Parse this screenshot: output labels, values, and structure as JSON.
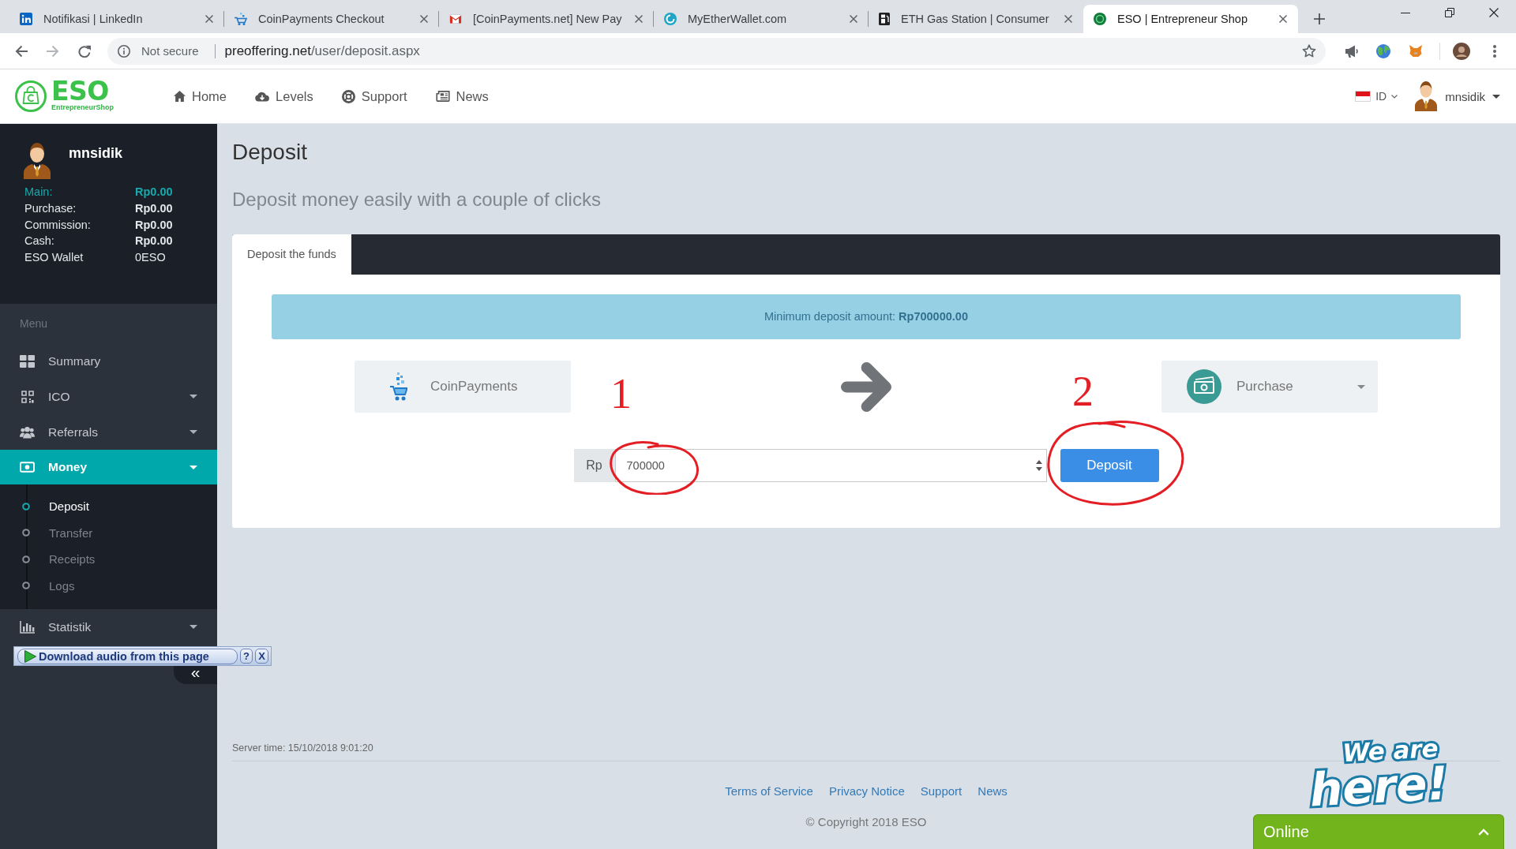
{
  "browser": {
    "tabs": [
      {
        "title": "Notifikasi | LinkedIn",
        "kind": "in-square",
        "selected": false
      },
      {
        "title": "CoinPayments Checkout",
        "kind": "cart",
        "selected": false
      },
      {
        "title": "[CoinPayments.net] New Pay",
        "kind": "mail",
        "selected": false
      },
      {
        "title": "MyEtherWallet.com",
        "kind": "swirl",
        "selected": false
      },
      {
        "title": "ETH Gas Station | Consumer",
        "kind": "pump",
        "selected": false
      },
      {
        "title": "ESO | Entrepreneur Shop",
        "kind": "disc",
        "selected": true
      }
    ],
    "address_bar": {
      "security": "Not secure",
      "host": "preoffering.net",
      "path": "/user/deposit.aspx"
    }
  },
  "header": {
    "logo": {
      "mark": "ESO",
      "tagline": "EntrepreneurShop"
    },
    "nav": [
      {
        "label": "Home",
        "kind": "home"
      },
      {
        "label": "Levels",
        "kind": "cloud"
      },
      {
        "label": "Support",
        "kind": "lifebuoy"
      },
      {
        "label": "News",
        "kind": "newspaper"
      }
    ],
    "language": "ID",
    "user": "mnsidik"
  },
  "sidebar": {
    "profile": {
      "name": "mnsidik",
      "balances": [
        {
          "label": "Main:",
          "value": "Rp0.00",
          "selected": true
        },
        {
          "label": "Purchase:",
          "value": "Rp0.00",
          "selected": false
        },
        {
          "label": "Commission:",
          "value": "Rp0.00",
          "selected": false
        },
        {
          "label": "Cash:",
          "value": "Rp0.00",
          "selected": false
        }
      ],
      "wallet": {
        "label": "ESO Wallet",
        "value": "0ESO"
      }
    },
    "menu_label": "Menu",
    "items": [
      {
        "label": "Summary",
        "kind": "grid",
        "dropdown": false,
        "selected": false
      },
      {
        "label": "ICO",
        "kind": "qr",
        "dropdown": true,
        "selected": false
      },
      {
        "label": "Referrals",
        "kind": "users",
        "dropdown": true,
        "selected": false
      },
      {
        "label": "Money",
        "kind": "money",
        "dropdown": true,
        "selected": true,
        "children": [
          {
            "label": "Deposit",
            "selected": true
          },
          {
            "label": "Transfer",
            "selected": false
          },
          {
            "label": "Receipts",
            "selected": false
          },
          {
            "label": "Logs",
            "selected": false
          }
        ]
      },
      {
        "label": "Statistik",
        "kind": "chart",
        "dropdown": true,
        "selected": false
      }
    ],
    "collapse": "«"
  },
  "page": {
    "title": "Deposit",
    "subtitle": "Deposit money easily with a couple of clicks"
  },
  "panel": {
    "tabs": [
      {
        "label": "Deposit the funds",
        "selected": true
      }
    ],
    "notice": "Minimum deposit amount: **Rp700000.00**",
    "source": {
      "label": "CoinPayments"
    },
    "target": {
      "label": "Purchase"
    },
    "amount": {
      "prefix": "Rp",
      "value": "700000"
    },
    "submit": "Deposit"
  },
  "annotations": [
    "1",
    "2"
  ],
  "footer": {
    "server_time": "Server time: 15/10/2018 9:01:20",
    "links": [
      "Terms of Service",
      "Privacy Notice",
      "Support",
      "News"
    ],
    "copyright": "© Copyright 2018 ESO"
  },
  "chat": {
    "badge": [
      "We are",
      "here!"
    ],
    "status": "Online"
  },
  "extension_bar": {
    "label": "Download audio from this page",
    "help": "?",
    "close": "X"
  }
}
